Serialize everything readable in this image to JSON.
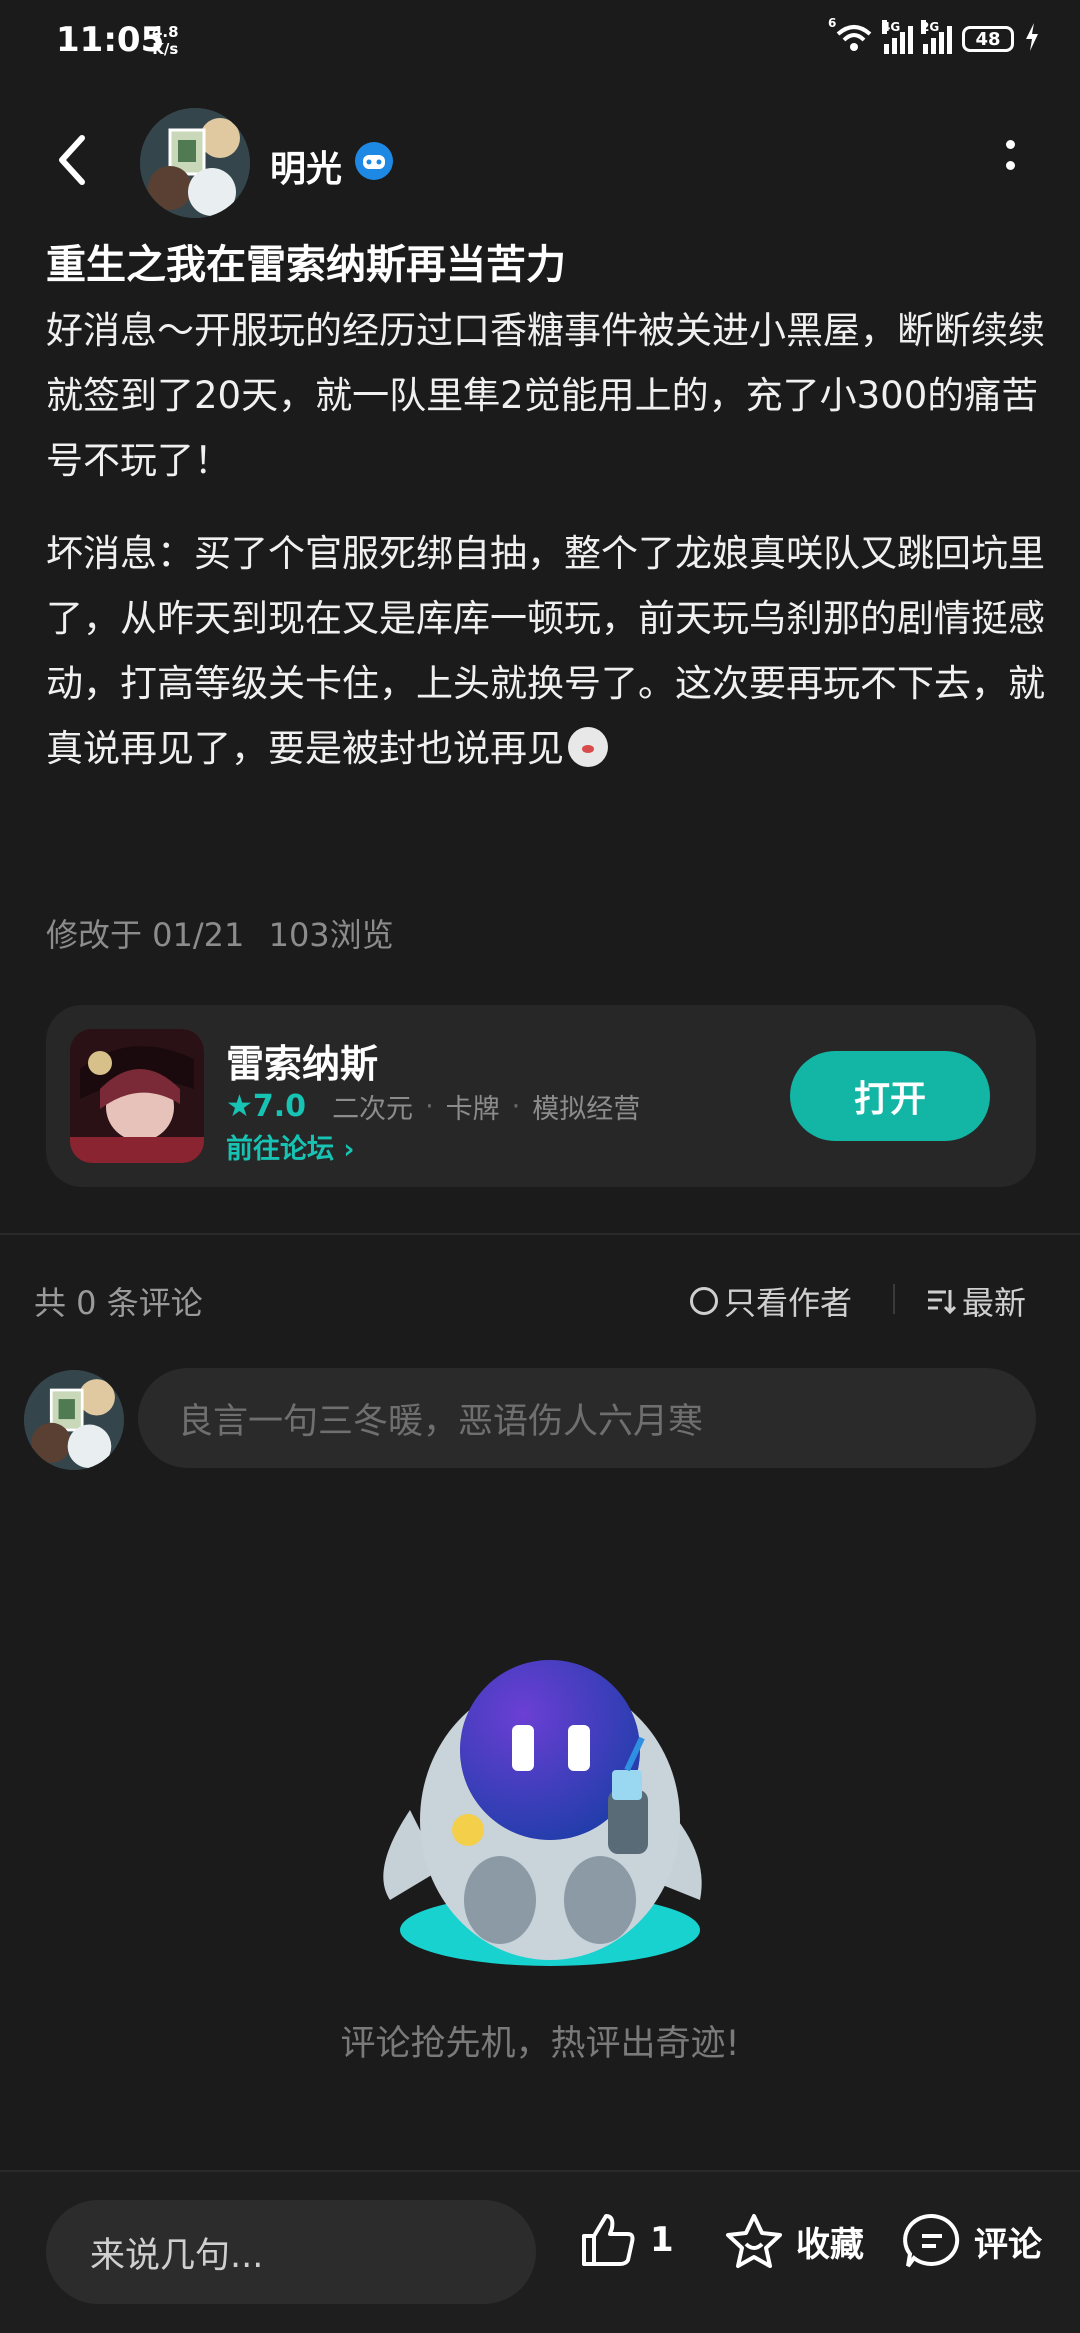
{
  "status_bar": {
    "time": "11:05",
    "speed_value": "4.8",
    "speed_unit": "K/s",
    "battery": "48",
    "sig1_tag": "4G",
    "sig2_tag": "2G",
    "wifi_tag": "6"
  },
  "header": {
    "author": "明光"
  },
  "post": {
    "title": "重生之我在雷索纳斯再当苦力",
    "paragraph1": "好消息～开服玩的经历过口香糖事件被关进小黑屋，断断续续就签到了20天，就一队里隼2觉能用上的，充了小300的痛苦号不玩了！",
    "paragraph2": "坏消息：买了个官服死绑自抽，整个了龙娘真咲队又跳回坑里了，从昨天到现在又是库库一顿玩，前天玩乌刹那的剧情挺感动，打高等级关卡住，上头就换号了。这次要再玩不下去，就真说再见了，要是被封也说再见",
    "modified": "修改于 01/21",
    "views": "103浏览"
  },
  "game_card": {
    "name": "雷索纳斯",
    "rating": "7.0",
    "tags": [
      "二次元",
      "卡牌",
      "模拟经营"
    ],
    "forum_link": "前往论坛",
    "open_button": "打开"
  },
  "comments": {
    "count_label": "共 0 条评论",
    "only_author": "只看作者",
    "sort": "最新",
    "input_placeholder": "良言一句三冬暖，恶语伤人六月寒",
    "empty_text": "评论抢先机，热评出奇迹!"
  },
  "bottom_bar": {
    "input_placeholder": "来说几句...",
    "like_count": "1",
    "collect_label": "收藏",
    "comment_label": "评论"
  },
  "colors": {
    "accent": "#13b5a5",
    "background": "#1b1b1b",
    "card": "#272727"
  }
}
